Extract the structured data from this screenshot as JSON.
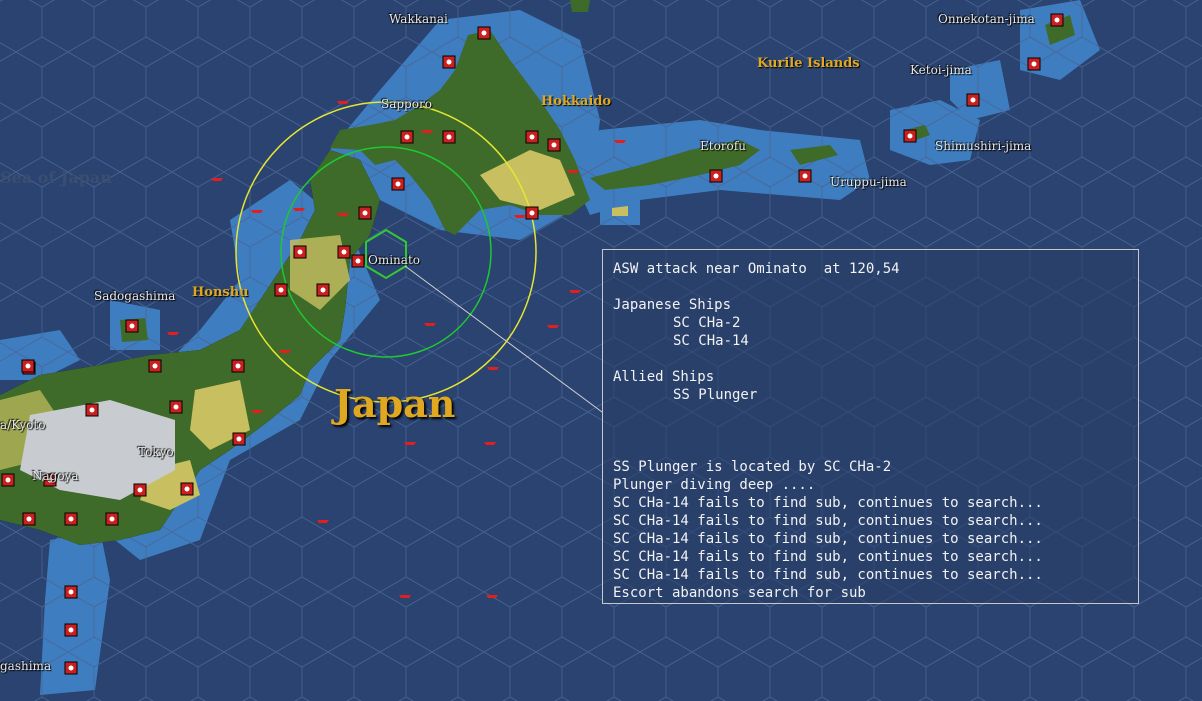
{
  "map": {
    "place_labels": [
      {
        "key": "wakkanai",
        "text": "Wakkanai"
      },
      {
        "key": "onnekotan",
        "text": "Onnekotan-jima"
      },
      {
        "key": "ketoi",
        "text": "Ketoi-jima"
      },
      {
        "key": "sapporo",
        "text": "Sapporo"
      },
      {
        "key": "etorofu",
        "text": "Etorofu"
      },
      {
        "key": "shimushiri",
        "text": "Shimushiri-jima"
      },
      {
        "key": "uruppu",
        "text": "Uruppu-jima"
      },
      {
        "key": "ominato",
        "text": "Ominato"
      },
      {
        "key": "sadogashima",
        "text": "Sadogashima"
      },
      {
        "key": "kyoto",
        "text": "a/Kyoto"
      },
      {
        "key": "tokyo",
        "text": "Tokyo"
      },
      {
        "key": "nagoya",
        "text": "Nagoya"
      },
      {
        "key": "gashima",
        "text": "gashima"
      }
    ],
    "region_labels": {
      "kurile": "Kurile Islands",
      "hokkaido": "Hokkaido",
      "honshu": "Honshu",
      "sea": "Sea of Japan"
    },
    "country_label": "Japan",
    "colors": {
      "ocean": "#2a4370",
      "shallow": "#3e7ec0",
      "land": "#3e6a2a",
      "clear": "#c8c060",
      "mountain": "#c8ccd0",
      "base": "#cc1f1f",
      "range_outer": "#e6e632",
      "range_inner": "#1ec832",
      "highlight": "#32c832"
    }
  },
  "combat_report": {
    "title": "ASW attack near Ominato  at 120,54",
    "japanese_header": "Japanese Ships",
    "japanese_ships": [
      "SC CHa-2",
      "SC CHa-14"
    ],
    "allied_header": "Allied Ships",
    "allied_ships": [
      "SS Plunger"
    ],
    "events": [
      "SS Plunger is located by SC CHa-2",
      "Plunger diving deep ....",
      "SC CHa-14 fails to find sub, continues to search...",
      "SC CHa-14 fails to find sub, continues to search...",
      "SC CHa-14 fails to find sub, continues to search...",
      "SC CHa-14 fails to find sub, continues to search...",
      "SC CHa-14 fails to find sub, continues to search...",
      "Escort abandons search for sub"
    ]
  }
}
